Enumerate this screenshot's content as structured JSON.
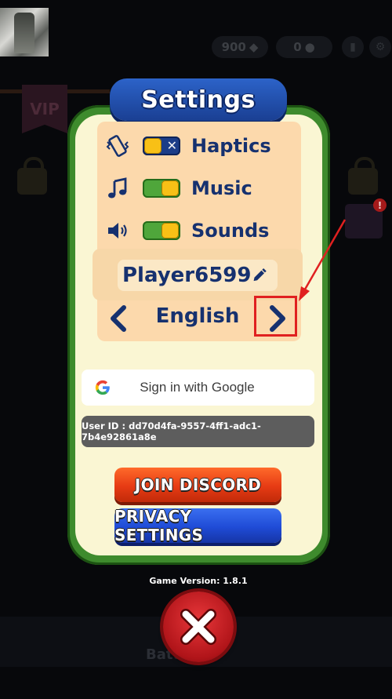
{
  "background": {
    "gems": "900",
    "coins": "0",
    "vip": "VIP",
    "mail_badge": "!",
    "battle_label": "Battle"
  },
  "settings": {
    "title": "Settings",
    "toggles": [
      {
        "label": "Haptics",
        "icon": "vibration-icon",
        "state": "off"
      },
      {
        "label": "Music",
        "icon": "music-note-icon",
        "state": "on"
      },
      {
        "label": "Sounds",
        "icon": "speaker-icon",
        "state": "on"
      }
    ],
    "player_name": "Player6599",
    "language": "English",
    "google_signin": "Sign in with Google",
    "user_id": "User ID : dd70d4fa-9557-4ff1-adc1-7b4e92861a8e",
    "join_discord": "JOIN DISCORD",
    "privacy_settings": "PRIVACY SETTINGS",
    "version": "Game Version: 1.8.1"
  },
  "colors": {
    "panel_green": "#3e8b2d",
    "panel_cream": "#faf6d3",
    "option_peach": "#fcd9ac",
    "text_navy": "#16316f",
    "discord_red": "#e63b14",
    "privacy_blue": "#1f4bd6",
    "close_red": "#c41a1e",
    "annotation_red": "#e02020"
  }
}
